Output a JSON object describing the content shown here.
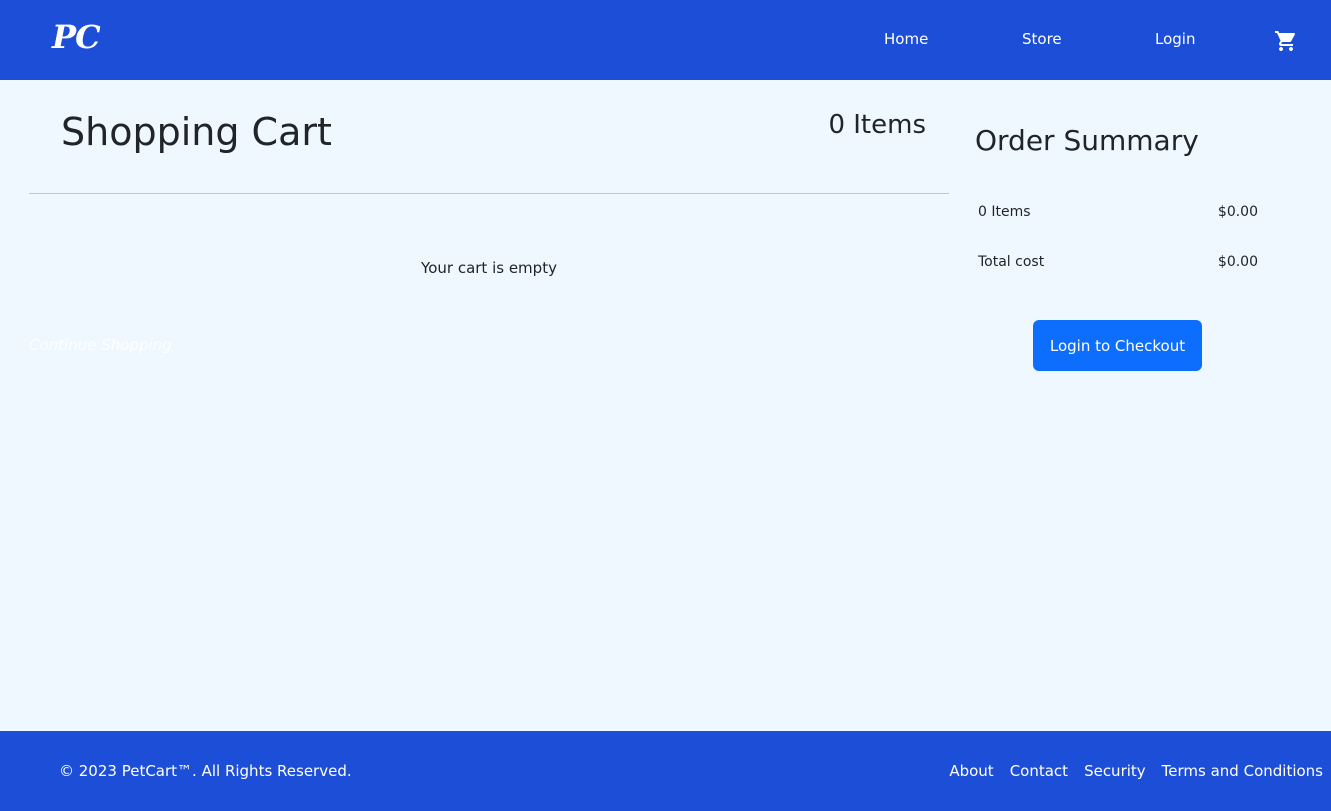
{
  "header": {
    "logo_text": "PC",
    "nav": {
      "home": "Home",
      "store": "Store",
      "login": "Login"
    },
    "cart_icon": "shopping-cart-icon"
  },
  "cart": {
    "title": "Shopping Cart",
    "item_count": "0 Items",
    "empty_message": "Your cart is empty",
    "continue_link": "Continue Shopping"
  },
  "summary": {
    "title": "Order Summary",
    "items_label": "0 Items",
    "items_value": "$0.00",
    "total_label": "Total cost",
    "total_value": "$0.00",
    "checkout_button": "Login to Checkout"
  },
  "footer": {
    "copyright": "© 2023 PetCart™. All Rights Reserved.",
    "links": [
      "About",
      "Contact",
      "Security",
      "Terms and Conditions"
    ]
  },
  "colors": {
    "brand": "#1d4ed8",
    "background": "#f0f8ff",
    "button": "#0d6efd"
  }
}
